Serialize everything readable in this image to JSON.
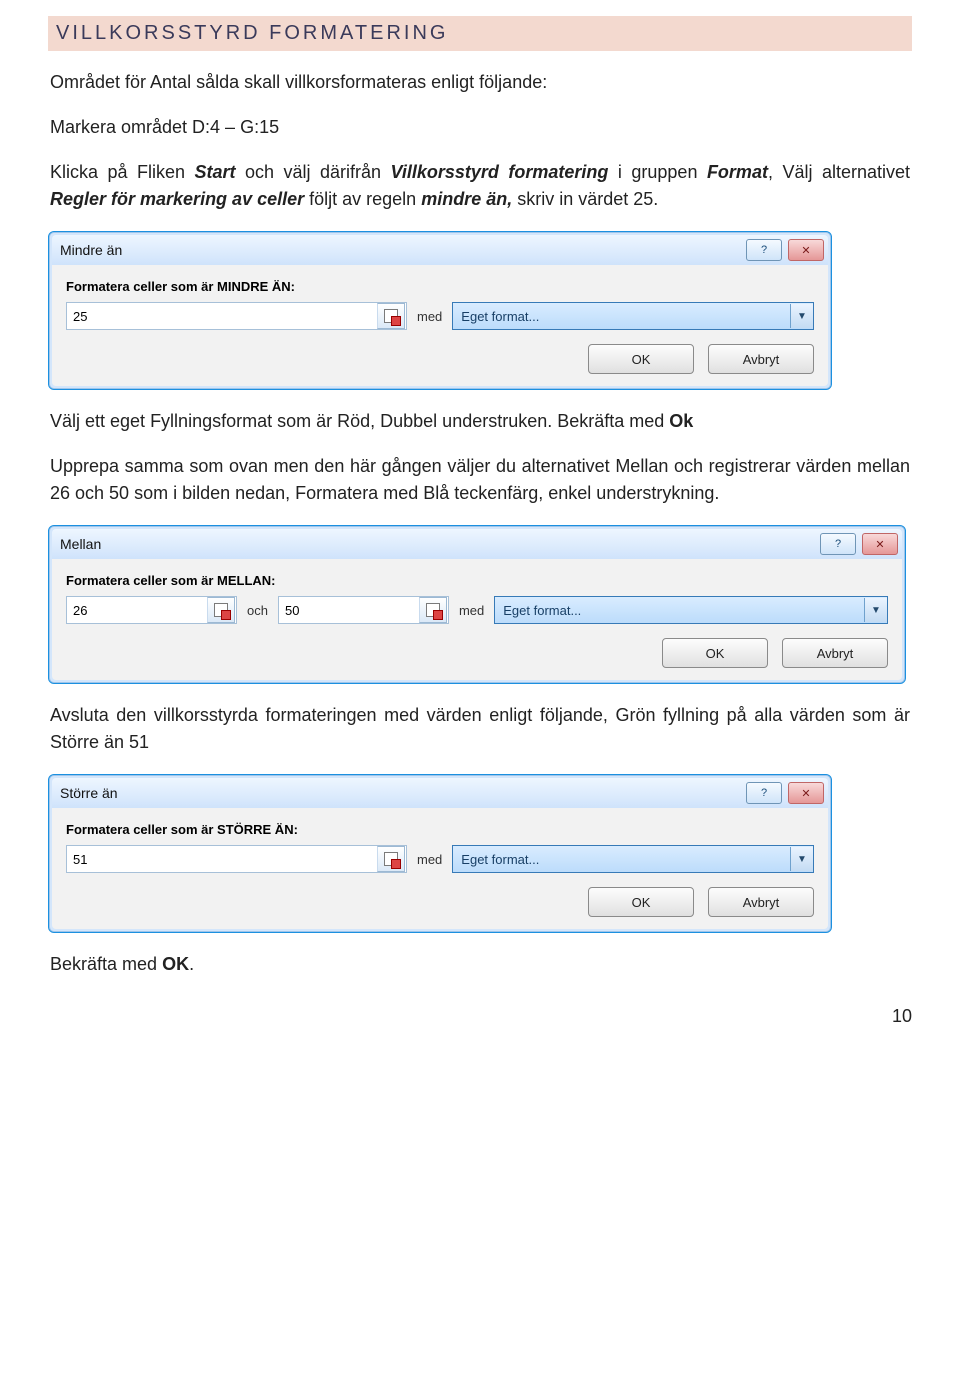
{
  "section_title": "VILLKORSSTYRD FORMATERING",
  "para1_pre": "Området för Antal sålda skall villkorsformateras enligt följande:",
  "para1b": "Markera området D:4 – G:15",
  "para2_parts": {
    "a": "Klicka på Fliken ",
    "b_i": "Start",
    "c": " och välj därifrån ",
    "d_i": "Villkorsstyrd formatering",
    "e": " i gruppen ",
    "f_i": "Format",
    "g": ", Välj alternativet ",
    "h_i": "Regler för markering av celler",
    "i": " följt av regeln ",
    "j_bi": "mindre än,",
    "k": " skriv in värdet 25."
  },
  "dlg1": {
    "title": "Mindre än",
    "label": "Formatera celler som är MINDRE ÄN:",
    "value": "25",
    "med": "med",
    "format": "Eget format...",
    "ok": "OK",
    "cancel": "Avbryt"
  },
  "para3_parts": {
    "a": "Välj ett eget Fyllningsformat som är Röd, Dubbel understruken. Bekräfta med ",
    "b_b": "Ok"
  },
  "para4": "Upprepa samma som ovan men den här gången väljer du alternativet Mellan och registrerar värden mellan 26 och 50 som i bilden nedan, Formatera med Blå teckenfärg, enkel understrykning.",
  "dlg2": {
    "title": "Mellan",
    "label": "Formatera celler som är MELLAN:",
    "value1": "26",
    "och": "och",
    "value2": "50",
    "med": "med",
    "format": "Eget format...",
    "ok": "OK",
    "cancel": "Avbryt"
  },
  "para5": "Avsluta den villkorsstyrda formateringen med värden enligt följande, Grön fyllning på alla värden som är Större än 51",
  "dlg3": {
    "title": "Större än",
    "label": "Formatera celler som är STÖRRE ÄN:",
    "value": "51",
    "med": "med",
    "format": "Eget format...",
    "ok": "OK",
    "cancel": "Avbryt"
  },
  "para6_parts": {
    "a": "Bekräfta med ",
    "b_b": "OK",
    "c": "."
  },
  "page_number": "10"
}
